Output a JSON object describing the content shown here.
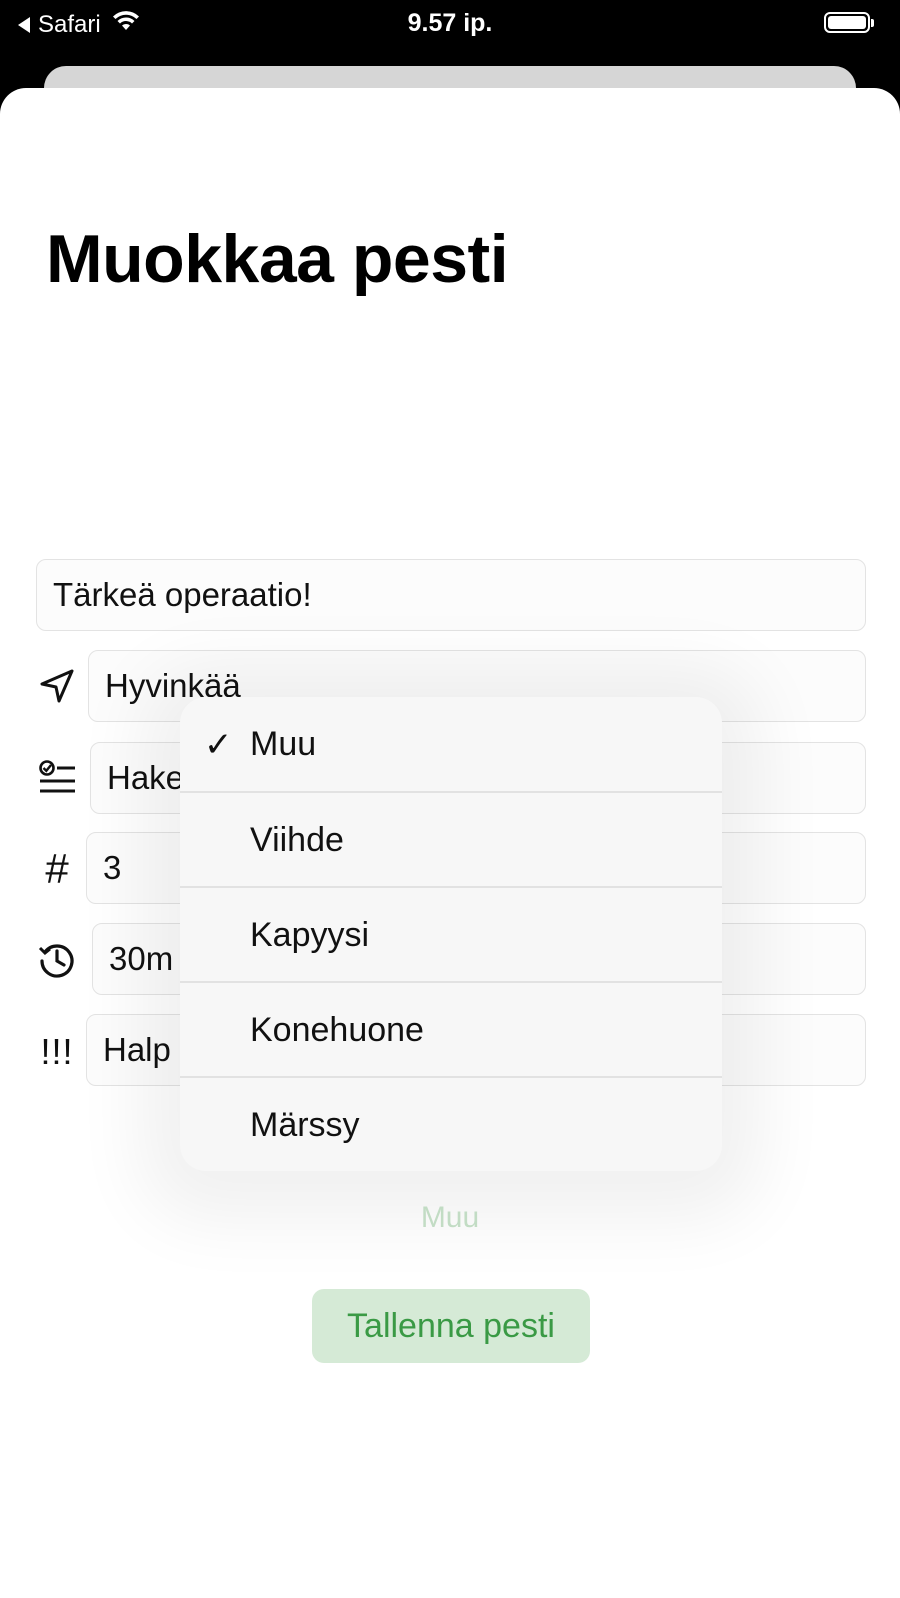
{
  "status_bar": {
    "back_app": "Safari",
    "time": "9.57 ip."
  },
  "page": {
    "title": "Muokkaa pesti"
  },
  "form": {
    "title_value": "Tärkeä operaatio!",
    "location_value": "Hyvinkää",
    "category_value": "Hake",
    "count_value": "3",
    "duration_value": "30m",
    "priority_value": "Halp",
    "priority_icon": "!!!"
  },
  "menu": {
    "items": [
      {
        "label": "Muu",
        "selected": true
      },
      {
        "label": "Viihde",
        "selected": false
      },
      {
        "label": "Kapyysi",
        "selected": false
      },
      {
        "label": "Konehuone",
        "selected": false
      },
      {
        "label": "Märssy",
        "selected": false
      }
    ],
    "check_glyph": "✓"
  },
  "picker": {
    "selected_value": "Muu"
  },
  "actions": {
    "save_label": "Tallenna pesti"
  },
  "icons": {
    "location": "location-arrow-icon",
    "category": "checklist-icon",
    "count": "hash-icon",
    "duration": "history-icon",
    "priority": "priority-icon"
  },
  "colors": {
    "accent_green": "#3a9a45",
    "button_bg": "#d5ead6"
  }
}
